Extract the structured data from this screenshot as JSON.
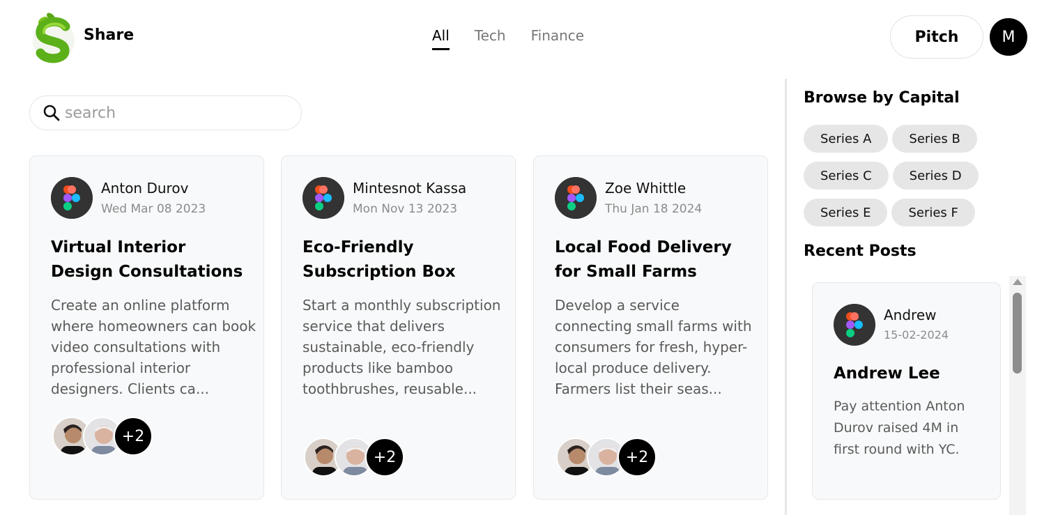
{
  "header": {
    "brand": "Share",
    "tabs": [
      {
        "label": "All",
        "active": true
      },
      {
        "label": "Tech",
        "active": false
      },
      {
        "label": "Finance",
        "active": false
      }
    ],
    "pitch_label": "Pitch",
    "user_initial": "M"
  },
  "search": {
    "placeholder": "search",
    "value": ""
  },
  "cards": [
    {
      "author": "Anton Durov",
      "date": "Wed Mar 08 2023",
      "title": "Virtual Interior Design Consultations",
      "description": "Create an online platform where homeowners can book video consultations with professional interior designers. Clients ca...",
      "more_investors": "+2"
    },
    {
      "author": "Mintesnot Kassa",
      "date": "Mon Nov 13 2023",
      "title": "Eco-Friendly Subscription Box",
      "description": "Start a monthly subscription service that delivers sustainable, eco-friendly products like bamboo toothbrushes, reusable...",
      "more_investors": "+2"
    },
    {
      "author": "Zoe Whittle",
      "date": "Thu Jan 18 2024",
      "title": "Local Food Delivery for Small Farms",
      "description": "Develop a service connecting small farms with consumers for fresh, hyper-local produce delivery. Farmers list their seas...",
      "more_investors": "+2"
    }
  ],
  "sidebar": {
    "browse_title": "Browse by Capital",
    "capitals": [
      "Series A",
      "Series B",
      "Series C",
      "Series D",
      "Series E",
      "Series F"
    ],
    "recent_title": "Recent Posts",
    "recent_post": {
      "author": "Andrew",
      "date": "15-02-2024",
      "title": "Andrew Lee",
      "description": "Pay attention Anton Durov raised 4M in first round with YC."
    }
  },
  "colors": {
    "accent": "#000000",
    "card_bg": "#f8f9fa",
    "chip_bg": "#e6e6e6",
    "muted_text": "#8b8b8b"
  },
  "icons": [
    "share-logo-icon",
    "search-icon",
    "figma-icon",
    "investor-avatar"
  ]
}
